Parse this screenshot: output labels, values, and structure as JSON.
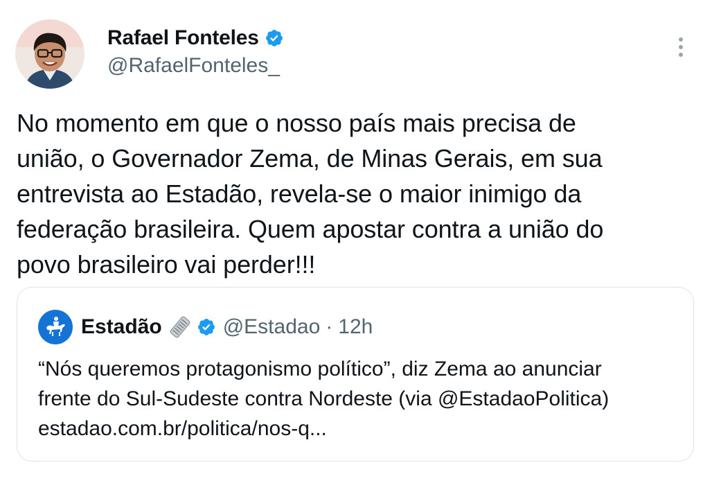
{
  "author": {
    "name": "Rafael Fonteles",
    "handle": "@RafaelFonteles_",
    "verified": true,
    "avatar_icon": "person-avatar"
  },
  "menu": {
    "icon": "more-vertical-icon"
  },
  "tweet": {
    "text": "No momento em que o nosso país mais precisa de\nunião, o Governador Zema, de Minas Gerais, em sua\nentrevista ao Estadão, revela-se o maior inimigo da\nfederação brasileira. Quem apostar contra a união do\npovo brasileiro vai perder!!!"
  },
  "quote": {
    "name": "Estadão",
    "handle": "@Estadao",
    "separator": "·",
    "time": "12h",
    "verified": true,
    "text": "“Nós queremos protagonismo político”, diz Zema ao anunciar\nfrente do Sul-Sudeste contra Nordeste (via @EstadaoPolitica)",
    "link": "estadao.com.br/politica/nos-q..."
  },
  "colors": {
    "verified_badge": "#1d9bf0",
    "secondary_text": "#536471",
    "estadao_blue": "#1673d6",
    "card_border": "#dfe3e7"
  }
}
